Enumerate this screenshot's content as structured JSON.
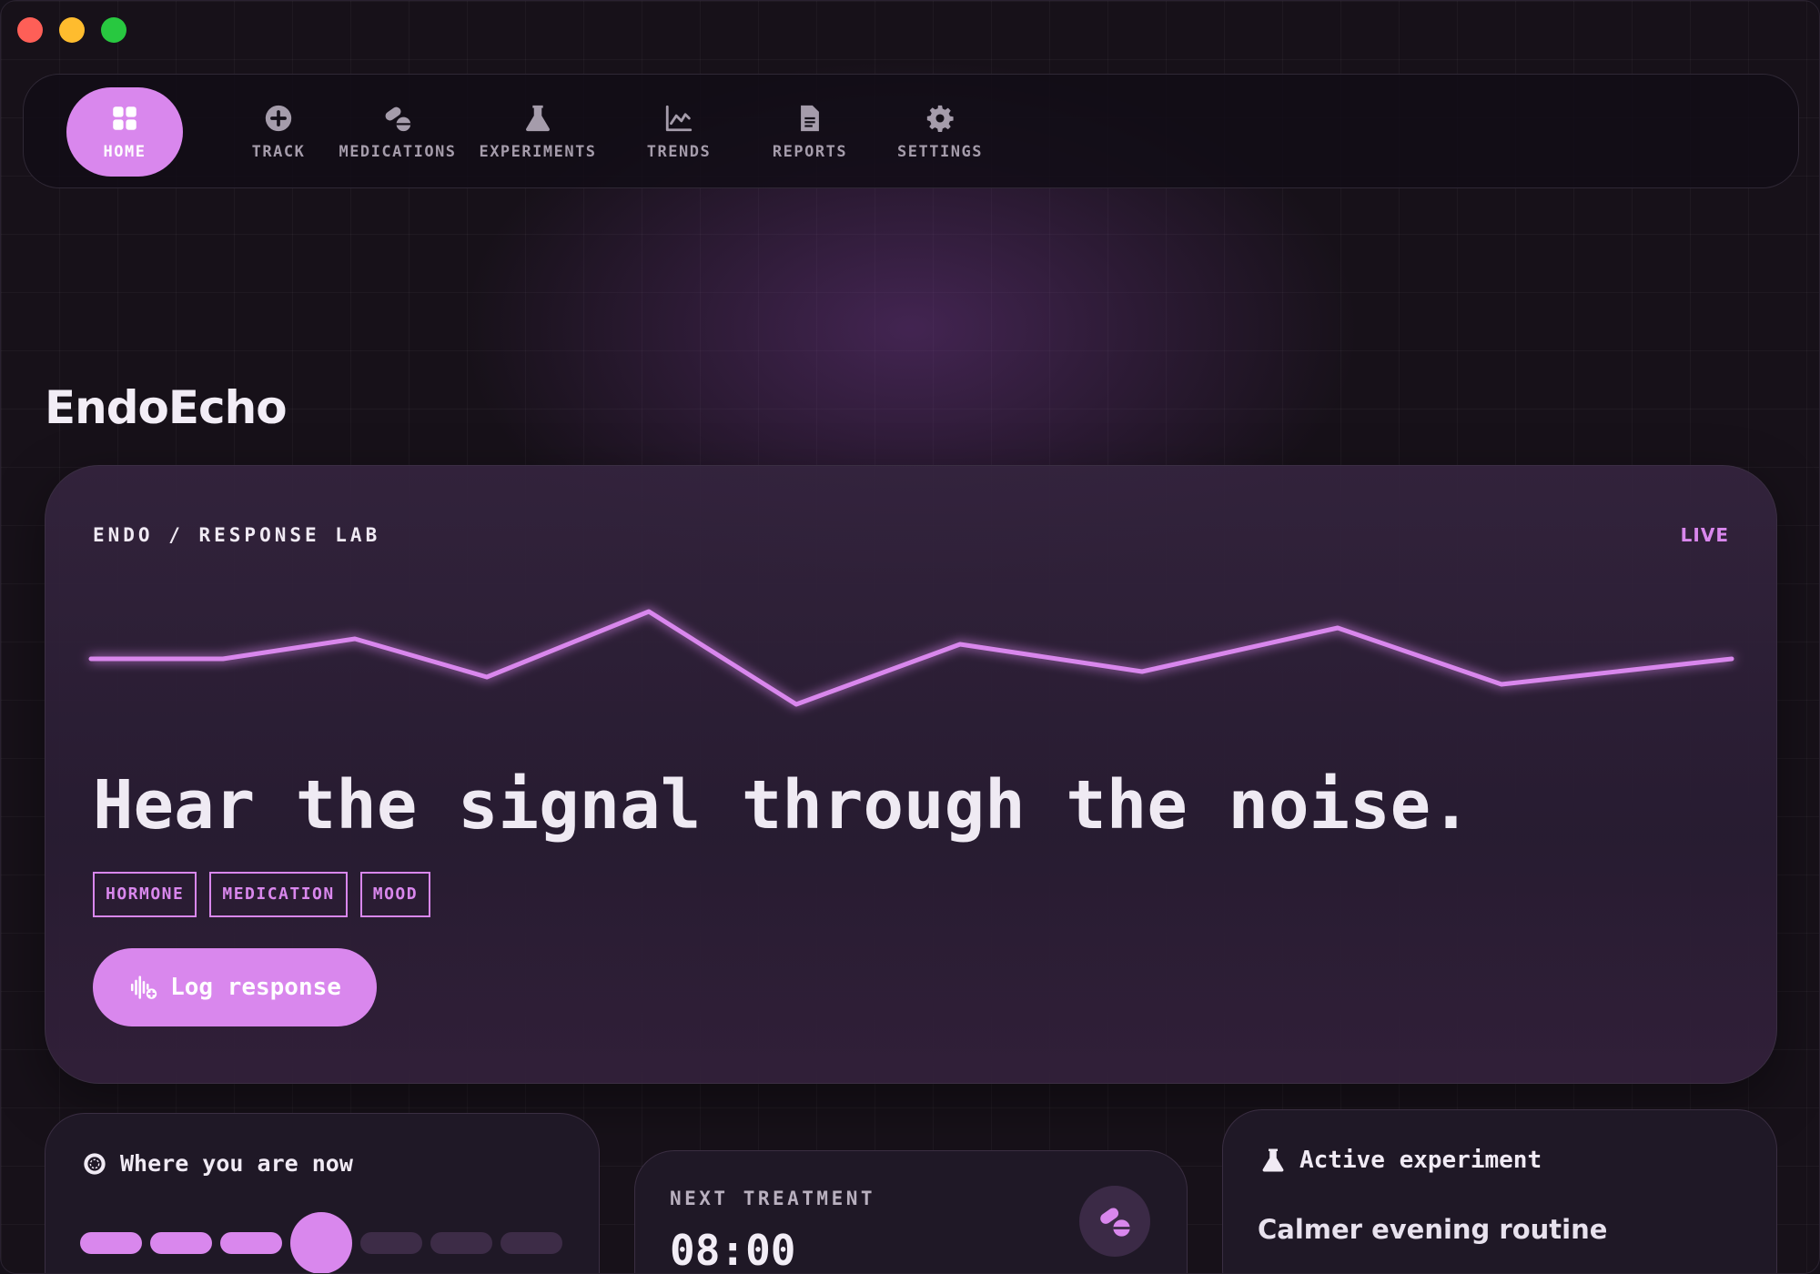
{
  "app": {
    "brand": "EndoEcho"
  },
  "nav": {
    "items": [
      {
        "label": "HOME",
        "icon": "grid-icon",
        "active": true
      },
      {
        "label": "TRACK",
        "icon": "plus-circle-icon",
        "active": false
      },
      {
        "label": "MEDICATIONS",
        "icon": "pills-icon",
        "active": false
      },
      {
        "label": "EXPERIMENTS",
        "icon": "flask-icon",
        "active": false
      },
      {
        "label": "TRENDS",
        "icon": "line-chart-icon",
        "active": false
      },
      {
        "label": "REPORTS",
        "icon": "document-icon",
        "active": false
      },
      {
        "label": "SETTINGS",
        "icon": "gear-icon",
        "active": false
      }
    ]
  },
  "hero": {
    "label": "ENDO / RESPONSE LAB",
    "status": "LIVE",
    "headline": "Hear the signal through the noise.",
    "tags": [
      "HORMONE",
      "MEDICATION",
      "MOOD"
    ],
    "action_label": "Log response",
    "action_icon": "audio-wave-plus-icon"
  },
  "cards": {
    "position": {
      "title": "Where you are now",
      "icon": "target-icon",
      "steps_total": 7,
      "current_step": 4
    },
    "treatment": {
      "label": "NEXT TREATMENT",
      "time": "08:00",
      "icon": "pills-icon"
    },
    "experiment": {
      "title": "Active experiment",
      "subtitle": "Calmer evening routine",
      "icon": "flask-icon"
    }
  },
  "colors": {
    "accent": "#d987ed",
    "background": "#151019",
    "card": "#1f1826"
  }
}
